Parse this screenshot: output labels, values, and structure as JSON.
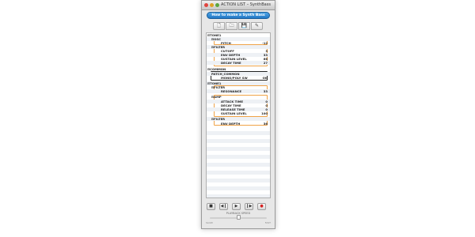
{
  "window": {
    "title": "ACTION LIST – SynthBass",
    "banner": "How to make a Synth Bass"
  },
  "toolbar": {
    "buttons": [
      {
        "icon": "new-document-icon",
        "glyph": "🗋"
      },
      {
        "icon": "open-folder-icon",
        "glyph": "🗀"
      },
      {
        "icon": "save-icon",
        "glyph": "💾"
      },
      {
        "icon": "edit-icon",
        "glyph": "✎"
      }
    ]
  },
  "list": {
    "rows": [
      {
        "label": "⊟TONE1",
        "value": ""
      },
      {
        "label": "⊟OSC",
        "value": ""
      },
      {
        "label": "PITCH",
        "value": "-12"
      },
      {
        "label": "⊟FILTER",
        "value": ""
      },
      {
        "label": "CUTOFF",
        "value": "3"
      },
      {
        "label": "ENV DEPTH",
        "value": "33"
      },
      {
        "label": "SUSTAIN LEVEL",
        "value": "66"
      },
      {
        "label": "DECAY TIME",
        "value": "27"
      },
      {
        "label": "⊟COMMON",
        "value": ""
      },
      {
        "label": "PATCH_COMMON",
        "value": ""
      },
      {
        "label": "MONO/POLY SW",
        "value": "ON"
      },
      {
        "label": "⊟TONE1",
        "value": ""
      },
      {
        "label": "⊟FILTER",
        "value": ""
      },
      {
        "label": "RESONANCE",
        "value": "33"
      },
      {
        "label": "⊟AMP",
        "value": ""
      },
      {
        "label": "ATTACK TIME",
        "value": "0"
      },
      {
        "label": "DECAY TIME",
        "value": "0"
      },
      {
        "label": "RELEASE TIME",
        "value": "0"
      },
      {
        "label": "SUSTAIN LEVEL",
        "value": "100"
      },
      {
        "label": "⊟FILTER",
        "value": ""
      },
      {
        "label": "ENV DEPTH",
        "value": "36"
      }
    ]
  },
  "transport": {
    "buttons": [
      {
        "icon": "stop-icon",
        "glyph": "■"
      },
      {
        "icon": "step-back-icon",
        "glyph": "◀❙"
      },
      {
        "icon": "play-icon",
        "glyph": "▶"
      },
      {
        "icon": "step-forward-icon",
        "glyph": "❙▶"
      },
      {
        "icon": "record-icon",
        "glyph": "●"
      }
    ],
    "speed_label": "PLAYBACK SPEED",
    "slow_label": "SLOW",
    "fast_label": "FAST",
    "speed_fraction": 0.5
  },
  "colors": {
    "accent": "#f0a347",
    "banner": "#2f86d4",
    "record": "#d42020"
  }
}
